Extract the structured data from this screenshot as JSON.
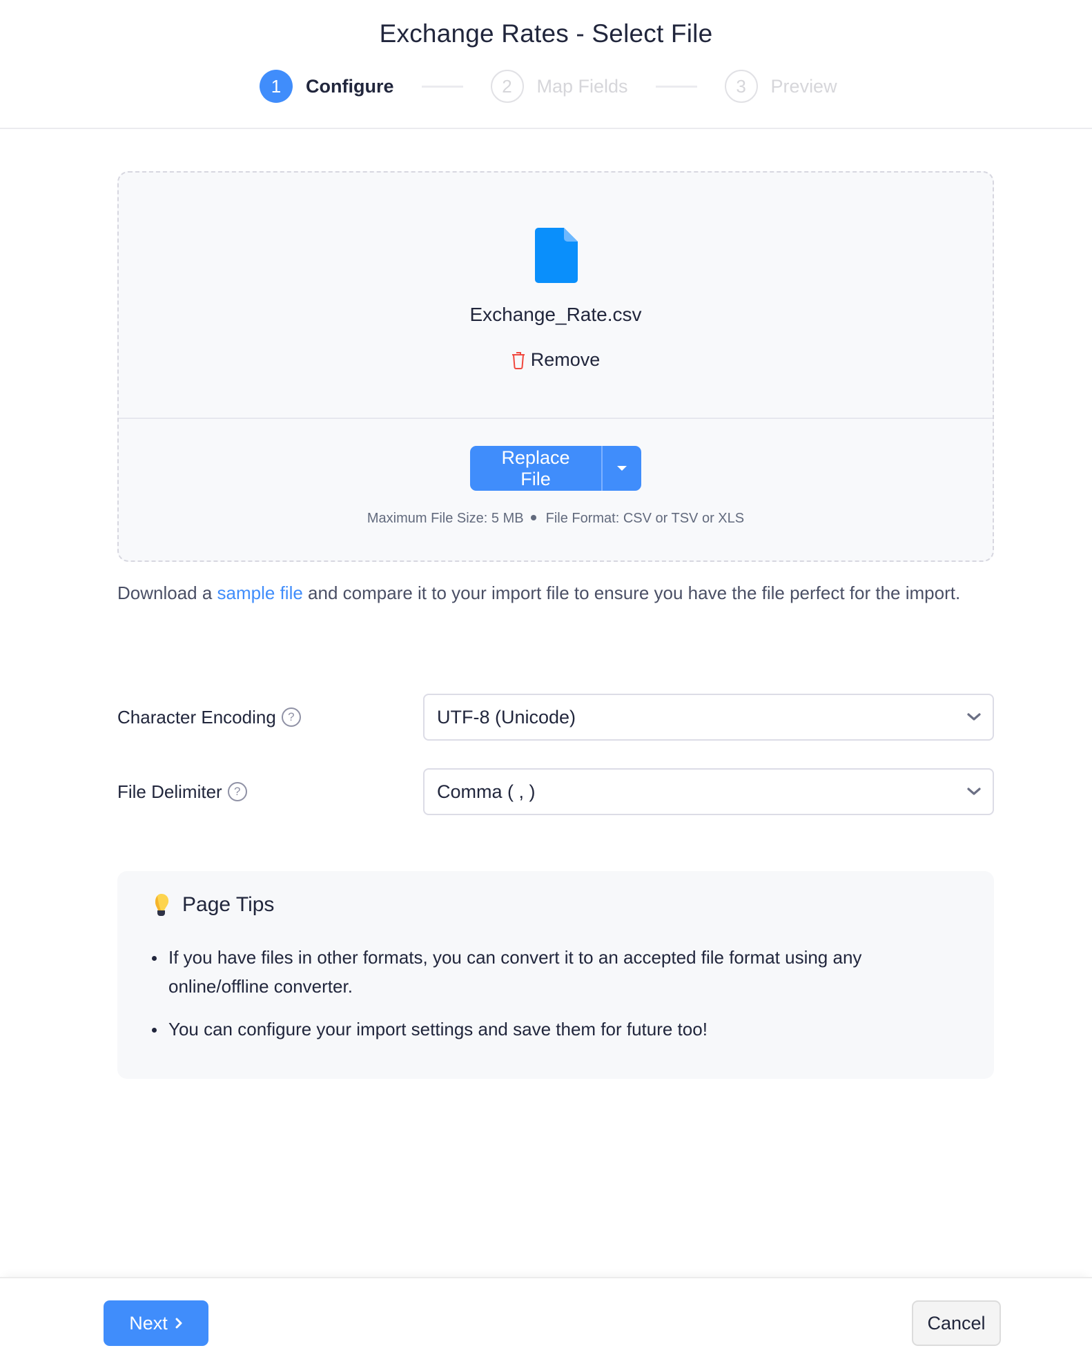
{
  "header": {
    "title": "Exchange Rates - Select File",
    "steps": [
      {
        "number": "1",
        "label": "Configure",
        "state": "active"
      },
      {
        "number": "2",
        "label": "Map Fields",
        "state": "inactive"
      },
      {
        "number": "3",
        "label": "Preview",
        "state": "inactive"
      }
    ]
  },
  "dropzone": {
    "file_icon": "document-icon",
    "file_name": "Exchange_Rate.csv",
    "remove_label": "Remove",
    "remove_icon": "trash-icon",
    "replace_label": "Replace File",
    "max_size": "Maximum File Size: 5 MB",
    "file_format": "File Format: CSV or TSV or XLS"
  },
  "sample": {
    "prefix": "Download a ",
    "link": "sample file",
    "suffix": " and compare it to your import file to ensure you have the file perfect for the import."
  },
  "form": {
    "encoding": {
      "label": "Character Encoding",
      "value": "UTF-8 (Unicode)"
    },
    "delimiter": {
      "label": "File Delimiter",
      "value": "Comma ( , )"
    },
    "help_glyph": "?"
  },
  "tips": {
    "title": "Page Tips",
    "icon": "lightbulb-icon",
    "items": [
      "If you have files in other formats, you can convert it to an accepted file format using any online/offline converter.",
      "You can configure your import settings and save them for future too!"
    ]
  },
  "footer": {
    "next_label": "Next",
    "cancel_label": "Cancel"
  },
  "colors": {
    "primary": "#408dfb",
    "danger": "#f0483e",
    "text": "#21263c",
    "muted": "#626a7d"
  }
}
